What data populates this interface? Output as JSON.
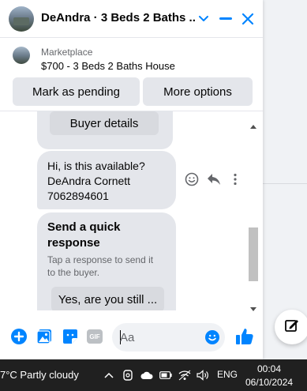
{
  "chat": {
    "title": "DeAndra · 3 Beds 2 Baths ...",
    "listing": {
      "label": "Marketplace",
      "title": "$700 - 3 Beds 2 Baths House"
    },
    "actions": {
      "pending_label": "Mark as pending",
      "more_label": "More options"
    },
    "messages": {
      "buyer_details_label": "Buyer details",
      "inquiry_lines": [
        "Hi, is this available?",
        "DeAndra Cornett",
        "7062894601"
      ],
      "quick_response": {
        "title_line1": "Send a quick",
        "title_line2": "response",
        "hint_line1": "Tap a response to send it",
        "hint_line2": "to the buyer.",
        "chip_label": "Yes, are you still ..."
      }
    },
    "composer": {
      "placeholder": "Aa",
      "gif_label": "GIF"
    }
  },
  "colors": {
    "accent": "#0084ff",
    "bubble": "#e4e6eb",
    "taskbar": "#202020"
  },
  "taskbar": {
    "weather": "7°C  Partly cloudy",
    "language": "ENG",
    "time": "00:04",
    "date": "06/10/2024"
  }
}
